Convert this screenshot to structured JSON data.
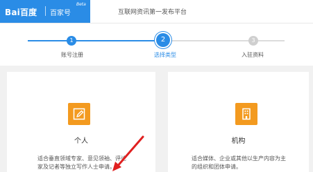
{
  "header": {
    "logo_text": "Bai百度",
    "brand": "百家号",
    "beta": "Beta",
    "slogan": "互联网资讯第一发布平台"
  },
  "steps": [
    {
      "num": "1",
      "label": "账号注册",
      "state": "done"
    },
    {
      "num": "2",
      "label": "选择类型",
      "state": "current"
    },
    {
      "num": "3",
      "label": "入驻资料",
      "state": "todo"
    }
  ],
  "cards": [
    {
      "title": "个人",
      "icon": "pencil-icon",
      "desc": "适合垂直领域专家、意见领袖、评论家及记者等独立写作人士申请。"
    },
    {
      "title": "机构",
      "icon": "building-icon",
      "desc": "适合媒体、企业或其他以生产内容为主的组织和团体申请。"
    }
  ],
  "colors": {
    "accent": "#2a8ce6",
    "icon_bg": "#f39a1f",
    "arrow": "#e02020"
  }
}
